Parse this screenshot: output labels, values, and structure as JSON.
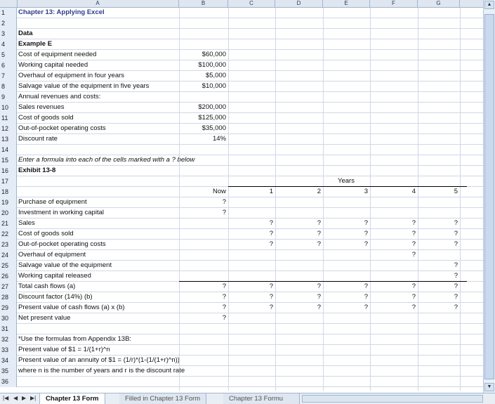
{
  "columns": [
    "A",
    "B",
    "C",
    "D",
    "E",
    "F",
    "G"
  ],
  "rows": [
    {
      "n": "1",
      "a": "Chapter 13: Applying Excel"
    },
    {
      "n": "2"
    },
    {
      "n": "3",
      "a": "Data"
    },
    {
      "n": "4",
      "a": "Example E"
    },
    {
      "n": "5",
      "a": "Cost of equipment needed",
      "b": "$60,000"
    },
    {
      "n": "6",
      "a": "Working capital needed",
      "b": "$100,000"
    },
    {
      "n": "7",
      "a": "Overhaul of equipment in four years",
      "b": "$5,000"
    },
    {
      "n": "8",
      "a": "Salvage value of the equipment in five years",
      "b": "$10,000"
    },
    {
      "n": "9",
      "a": "Annual revenues and costs:"
    },
    {
      "n": "10",
      "a": "  Sales revenues",
      "b": "$200,000"
    },
    {
      "n": "11",
      "a": "  Cost of goods sold",
      "b": "$125,000"
    },
    {
      "n": "12",
      "a": "  Out-of-pocket operating costs",
      "b": "$35,000"
    },
    {
      "n": "13",
      "a": "Discount rate",
      "b": "14%"
    },
    {
      "n": "14"
    },
    {
      "n": "15",
      "a": "Enter a formula into each of the cells marked with a ? below"
    },
    {
      "n": "16",
      "a": "Exhibit 13-8"
    },
    {
      "n": "17",
      "e": "Years"
    },
    {
      "n": "18",
      "b": "Now",
      "c": "1",
      "d": "2",
      "e": "3",
      "f": "4",
      "g": "5"
    },
    {
      "n": "19",
      "a": "Purchase of equipment",
      "b": "?"
    },
    {
      "n": "20",
      "a": "Investment in working capital",
      "b": "?"
    },
    {
      "n": "21",
      "a": "Sales",
      "c": "?",
      "d": "?",
      "e": "?",
      "f": "?",
      "g": "?"
    },
    {
      "n": "22",
      "a": "Cost of goods sold",
      "c": "?",
      "d": "?",
      "e": "?",
      "f": "?",
      "g": "?"
    },
    {
      "n": "23",
      "a": "Out-of-pocket operating costs",
      "c": "?",
      "d": "?",
      "e": "?",
      "f": "?",
      "g": "?"
    },
    {
      "n": "24",
      "a": "Overhaul of equipment",
      "f": "?"
    },
    {
      "n": "25",
      "a": "Salvage value of the equipment",
      "g": "?"
    },
    {
      "n": "26",
      "a": "Working capital released",
      "g": "?"
    },
    {
      "n": "27",
      "a": "Total cash flows (a)",
      "b": "?",
      "c": "?",
      "d": "?",
      "e": "?",
      "f": "?",
      "g": "?"
    },
    {
      "n": "28",
      "a": "Discount factor (14%) (b)",
      "b": "?",
      "c": "?",
      "d": "?",
      "e": "?",
      "f": "?",
      "g": "?"
    },
    {
      "n": "29",
      "a": "Present value of cash flows (a) x (b)",
      "b": "?",
      "c": "?",
      "d": "?",
      "e": "?",
      "f": "?",
      "g": "?"
    },
    {
      "n": "30",
      "a": "Net present value",
      "b": "?"
    },
    {
      "n": "31"
    },
    {
      "n": "32",
      "a": "*Use the formulas from Appendix 13B:"
    },
    {
      "n": "33",
      "a": "   Present value of $1 = 1/(1+r)^n"
    },
    {
      "n": "34",
      "a": "   Present value of an annuity of $1 = (1/r)*(1-(1/(1+r)^n))"
    },
    {
      "n": "35",
      "a": "   where n is the number of years and r is the discount rate"
    },
    {
      "n": "36"
    }
  ],
  "tabs": [
    "Chapter 13 Form",
    "Filled in Chapter 13 Form",
    "Chapter 13 Formu"
  ],
  "nav_icons": [
    "first-sheet-icon",
    "prev-sheet-icon",
    "next-sheet-icon",
    "last-sheet-icon"
  ],
  "colors": {
    "title": "#2d3c8a",
    "header_bg": "#dfe6ef",
    "gridline": "#d0d7e5"
  }
}
